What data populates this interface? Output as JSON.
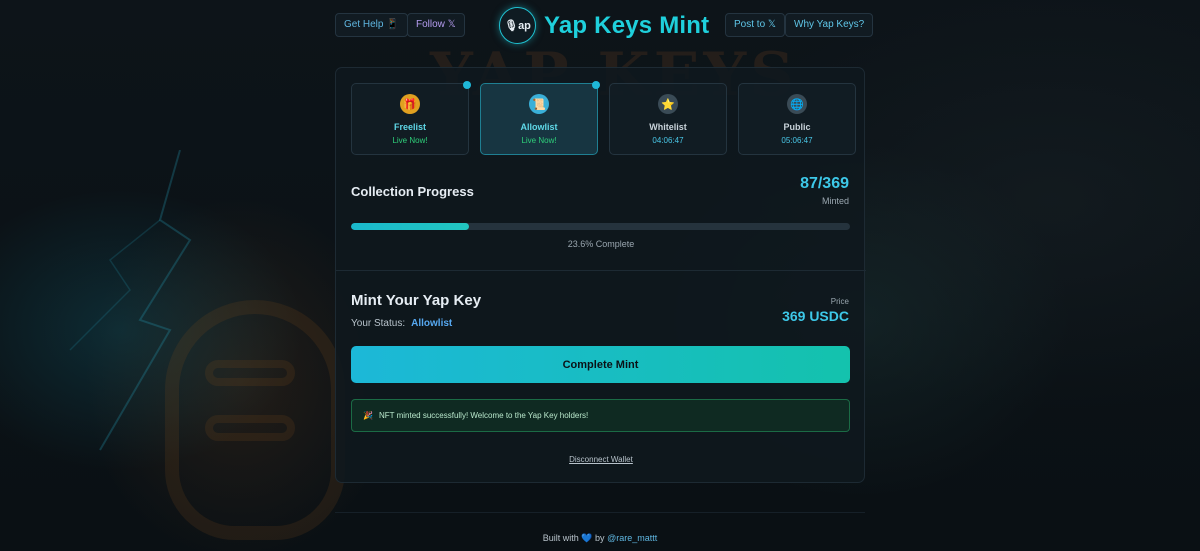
{
  "header": {
    "get_help": "Get Help 📱",
    "follow": "Follow 𝕏",
    "title": "Yap Keys Mint",
    "logo_text": "ap",
    "post": "Post to 𝕏",
    "why": "Why Yap Keys?"
  },
  "phases": [
    {
      "name": "Freelist",
      "status": "Live Now!",
      "icon": "gift-icon",
      "live": true
    },
    {
      "name": "Allowlist",
      "status": "Live Now!",
      "icon": "scroll-icon",
      "live": true
    },
    {
      "name": "Whitelist",
      "status": "04:06:47",
      "icon": "star-icon",
      "live": false
    },
    {
      "name": "Public",
      "status": "05:06:47",
      "icon": "globe-icon",
      "live": false
    }
  ],
  "progress": {
    "title": "Collection Progress",
    "count": "87/369",
    "minted_label": "Minted",
    "percent_value": 23.6,
    "percent_text": "23.6% Complete"
  },
  "mint": {
    "title": "Mint Your Yap Key",
    "status_label": "Your Status:",
    "status_value": "Allowlist",
    "price_label": "Price",
    "price_value": "369 USDC",
    "button": "Complete Mint",
    "success_message": "NFT minted successfully! Welcome to the Yap Key holders!",
    "disconnect": "Disconnect Wallet"
  },
  "footer": {
    "built_with": "Built with",
    "by": "by",
    "handle": "@rare_mattt"
  },
  "colors": {
    "accent": "#1fd0dc",
    "live": "#2fd07a",
    "success_border": "#1b6b45"
  }
}
